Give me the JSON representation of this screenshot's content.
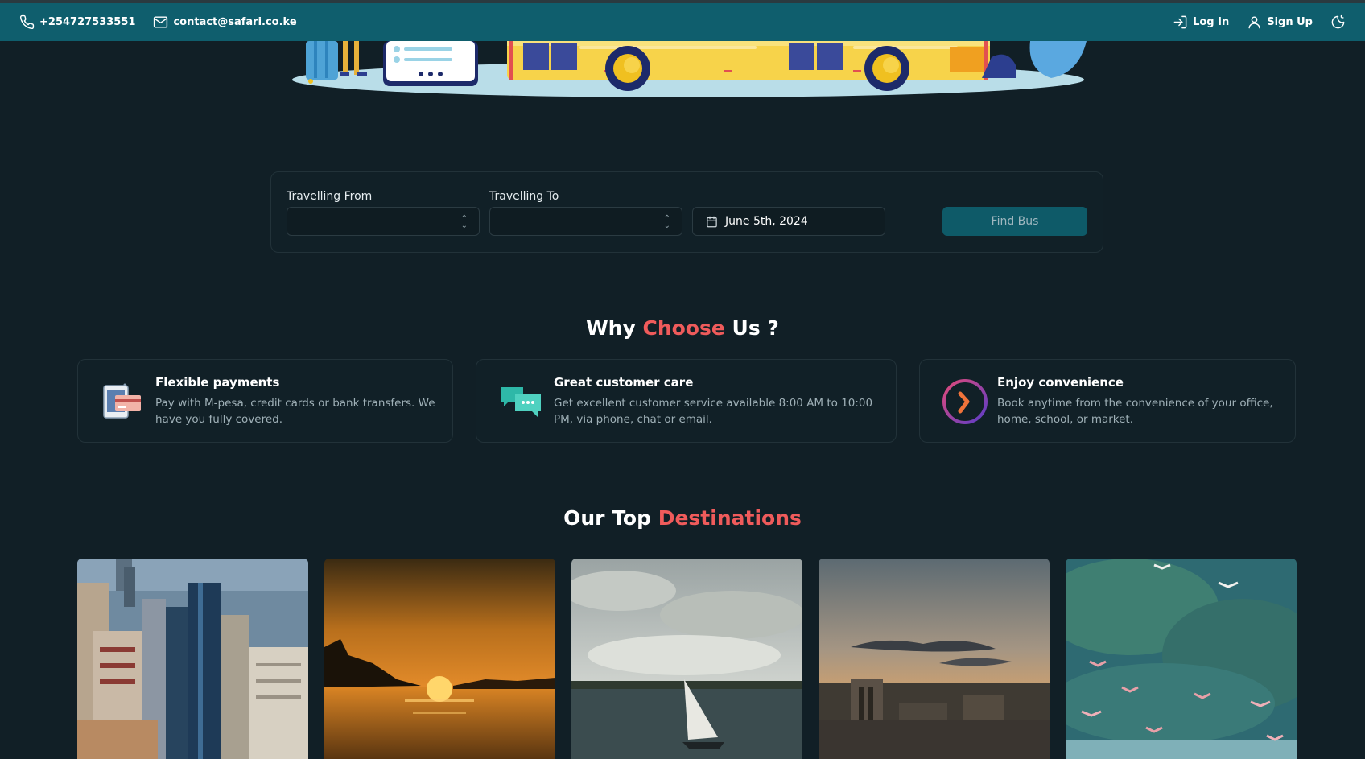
{
  "header": {
    "phone": "+254727533551",
    "email": "contact@safari.co.ke",
    "login_label": "Log In",
    "signup_label": "Sign Up",
    "icons": [
      "phone-icon",
      "mail-icon",
      "login-icon",
      "user-icon",
      "theme-toggle-icon"
    ]
  },
  "search": {
    "from_label": "Travelling From",
    "to_label": "Travelling To",
    "from_value": "",
    "to_value": "",
    "date_value": "June 5th, 2024",
    "button_label": "Find Bus"
  },
  "why": {
    "title_start": "Why",
    "title_accent": "Choose",
    "title_end": "Us ?",
    "features": [
      {
        "title": "Flexible payments",
        "description": "Pay with M-pesa, credit cards or bank transfers. We have you fully covered.",
        "icon": "payment-card-icon"
      },
      {
        "title": "Great customer care",
        "description": "Get excellent customer service available 8:00 AM to 10:00 PM, via phone, chat or email.",
        "icon": "chat-bubbles-icon"
      },
      {
        "title": "Enjoy convenience",
        "description": "Book anytime from the convenience of your office, home, school, or market.",
        "icon": "clock-icon"
      }
    ]
  },
  "destinations": {
    "title_start": "Our Top",
    "title_accent": "Destinations"
  },
  "colors": {
    "background": "#111f26",
    "topbar": "#0f5e6d",
    "accent": "#ef5b5b",
    "button": "#0e5a68"
  }
}
